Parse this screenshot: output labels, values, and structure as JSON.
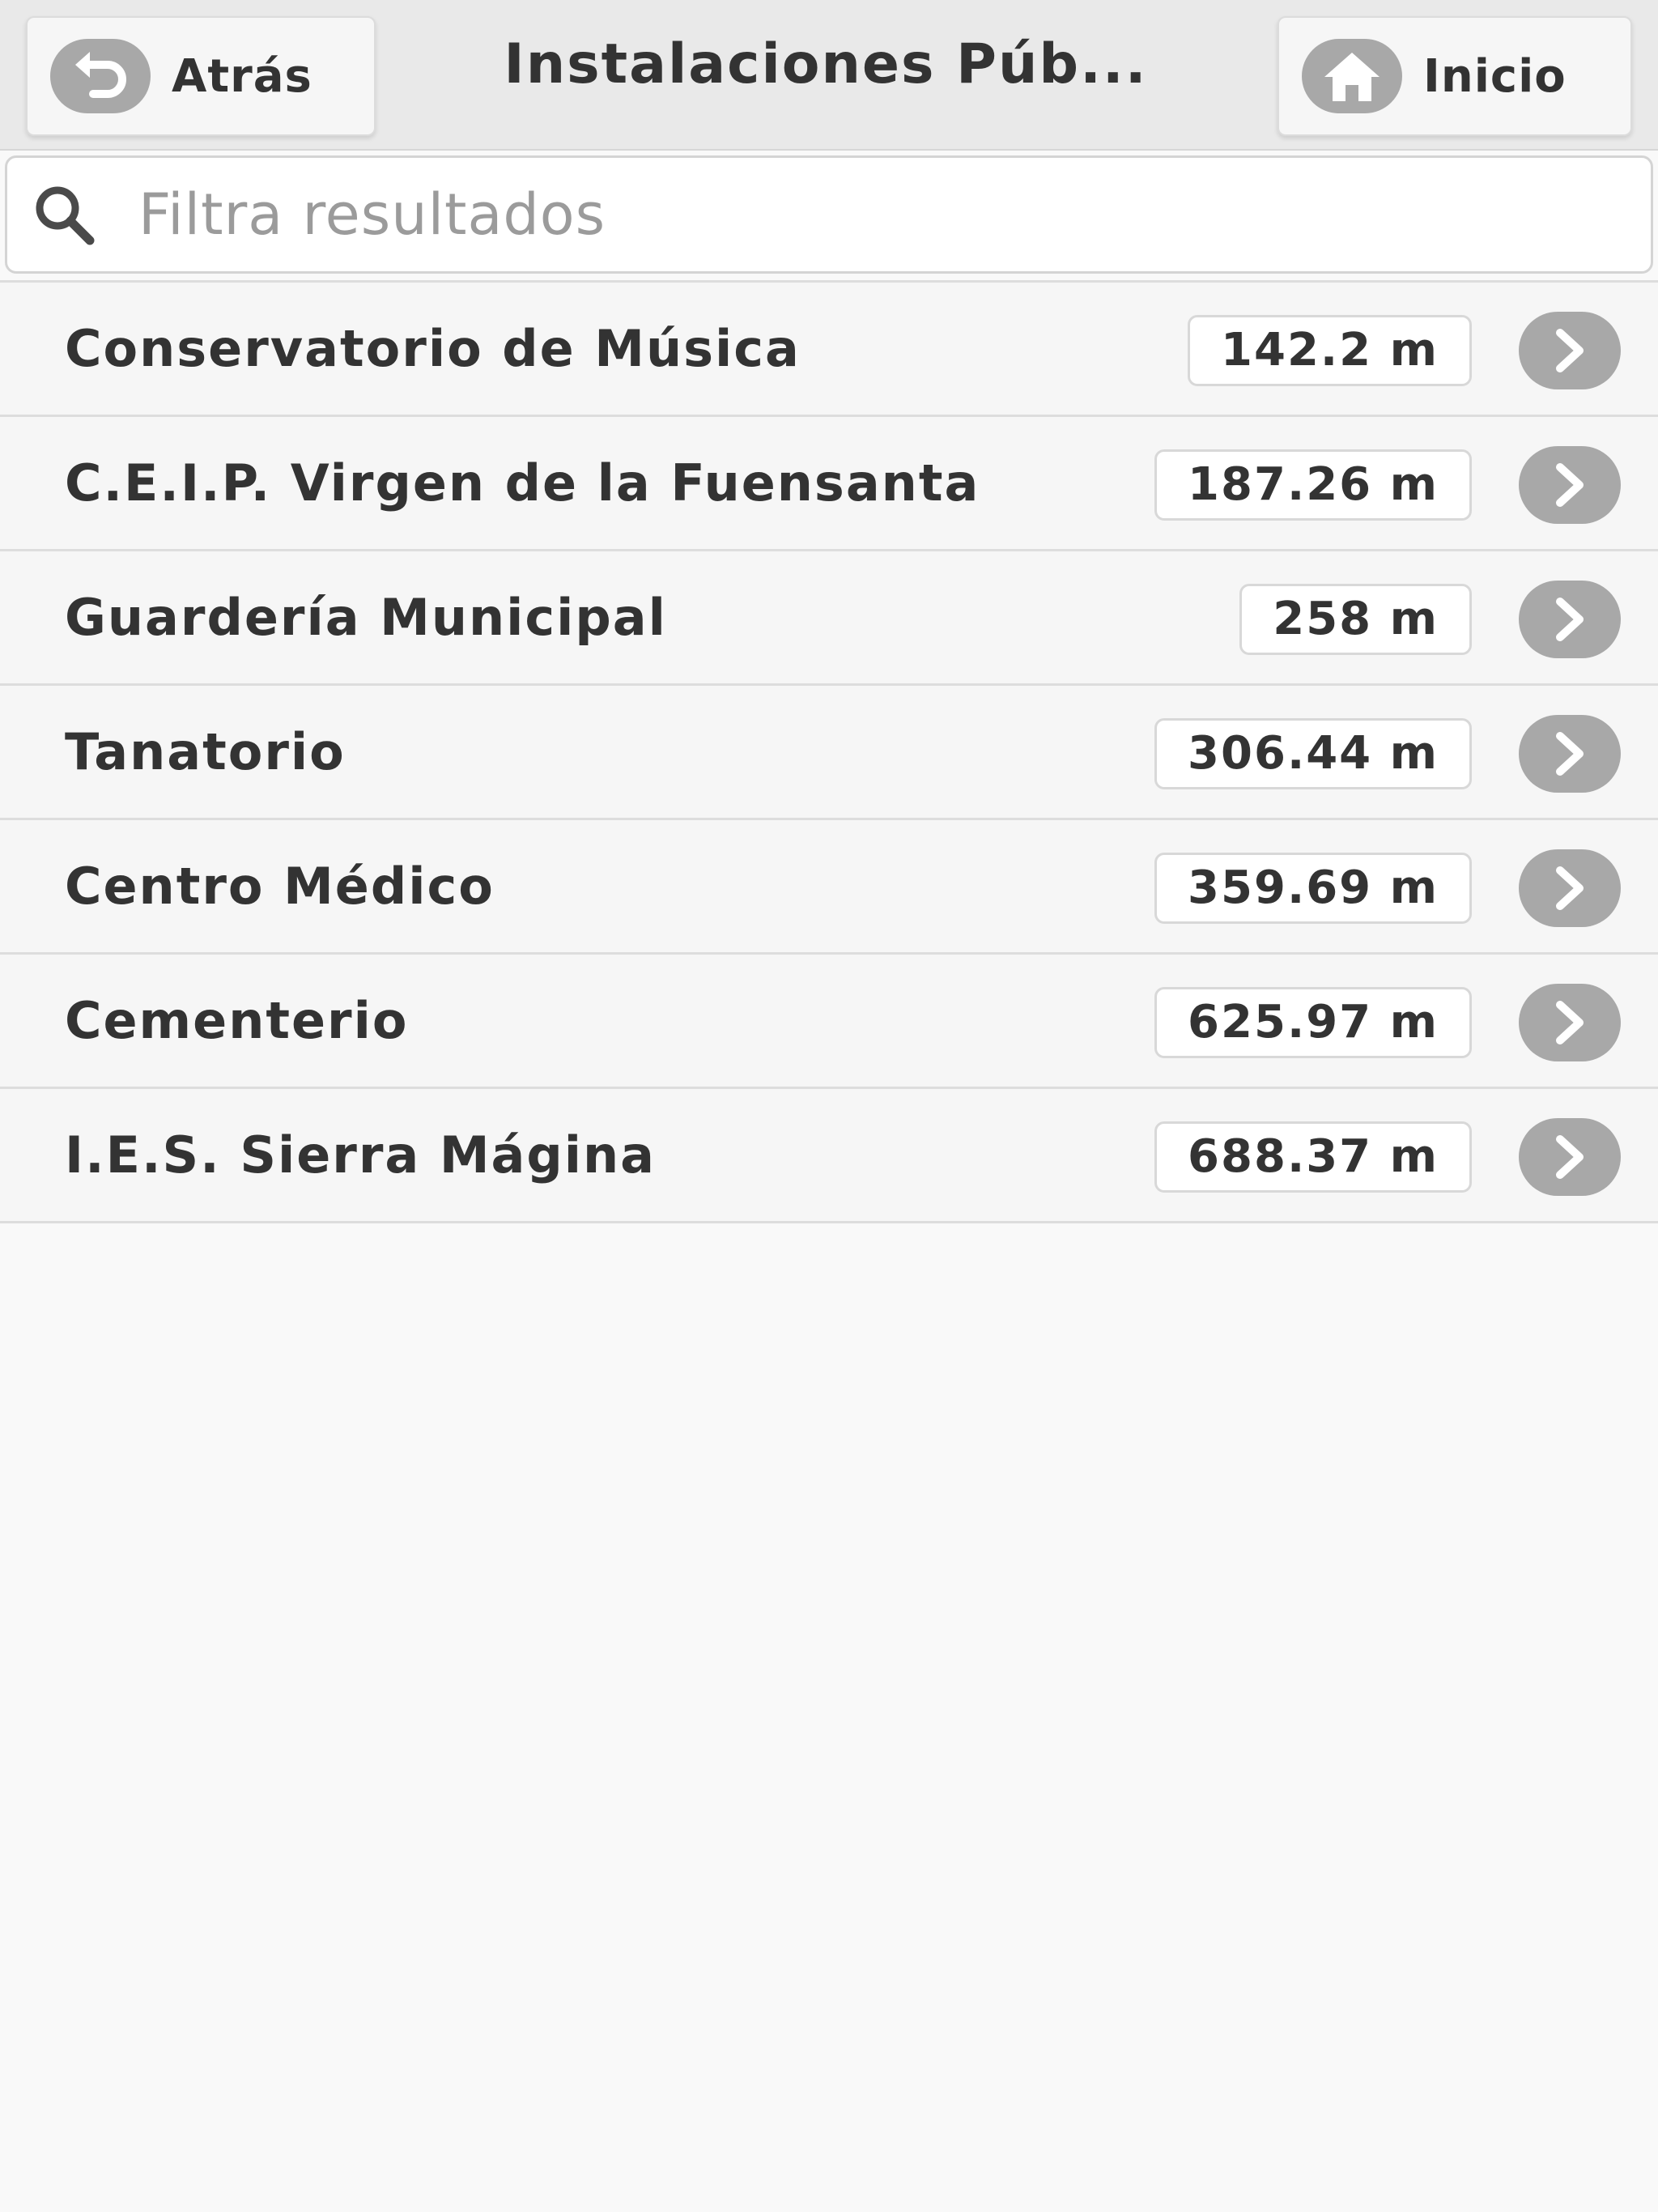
{
  "header": {
    "back_label": "Atrás",
    "title": "Instalaciones Púb...",
    "home_label": "Inicio"
  },
  "search": {
    "placeholder": "Filtra resultados",
    "value": ""
  },
  "items": [
    {
      "name": "Conservatorio de Música",
      "distance": "142.2 m"
    },
    {
      "name": "C.E.I.P. Virgen de la Fuensanta",
      "distance": "187.26 m"
    },
    {
      "name": "Guardería Municipal",
      "distance": "258 m"
    },
    {
      "name": "Tanatorio",
      "distance": "306.44 m"
    },
    {
      "name": "Centro Médico",
      "distance": "359.69 m"
    },
    {
      "name": "Cementerio",
      "distance": "625.97 m"
    },
    {
      "name": "I.E.S. Sierra Mágina",
      "distance": "688.37 m"
    }
  ],
  "colors": {
    "header_bg": "#e9e9e9",
    "page_bg": "#f9f9f9",
    "icon_circle": "#a8a8a8",
    "text": "#333333"
  }
}
